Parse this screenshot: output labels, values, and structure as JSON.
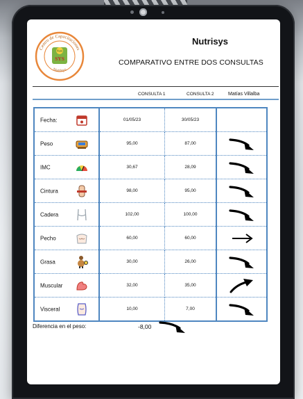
{
  "header": {
    "brand": "Nutrisys",
    "title": "COMPARATIVO ENTRE DOS CONSULTAS",
    "col_1": "CONSULTA 1",
    "col_2": "CONSULTA 2",
    "patient": "Matías Villalba"
  },
  "logo": {
    "ring_text": "Centro de Capacitaciones",
    "bottom_text": "Nutrisys",
    "badge_top": "Nutri",
    "badge_bottom": "SYS",
    "colors": {
      "ring": "#e8873a",
      "badge_green": "#7cb342",
      "badge_text": "#c62828"
    }
  },
  "rows": [
    {
      "label": "Fecha:",
      "icon": "calendar-icon",
      "v1": "01/05/23",
      "v2": "30/05/23",
      "trend": "none"
    },
    {
      "label": "Peso",
      "icon": "scale-icon",
      "v1": "95,00",
      "v2": "87,00",
      "trend": "down"
    },
    {
      "label": "IMC",
      "icon": "gauge-icon",
      "v1": "30,67",
      "v2": "28,09",
      "trend": "down"
    },
    {
      "label": "Cintura",
      "icon": "waist-icon",
      "v1": "98,00",
      "v2": "95,00",
      "trend": "down"
    },
    {
      "label": "Cadera",
      "icon": "hip-icon",
      "v1": "102,00",
      "v2": "100,00",
      "trend": "down"
    },
    {
      "label": "Pecho",
      "icon": "chest-icon",
      "v1": "60,00",
      "v2": "60,00",
      "trend": "flat"
    },
    {
      "label": "Grasa",
      "icon": "fat-figure-icon",
      "v1": "30,00",
      "v2": "26,00",
      "trend": "down"
    },
    {
      "label": "Muscular",
      "icon": "flexed-arm-icon",
      "v1": "32,00",
      "v2": "35,00",
      "trend": "up"
    },
    {
      "label": "Visceral",
      "icon": "torso-icon",
      "v1": "10,00",
      "v2": "7,00",
      "trend": "down"
    }
  ],
  "difference": {
    "label": "Diferencia en el peso:",
    "value": "-8,00",
    "trend": "down"
  },
  "colors": {
    "table_border": "#4e86c0",
    "accent_rule": "#6f9ecb"
  }
}
